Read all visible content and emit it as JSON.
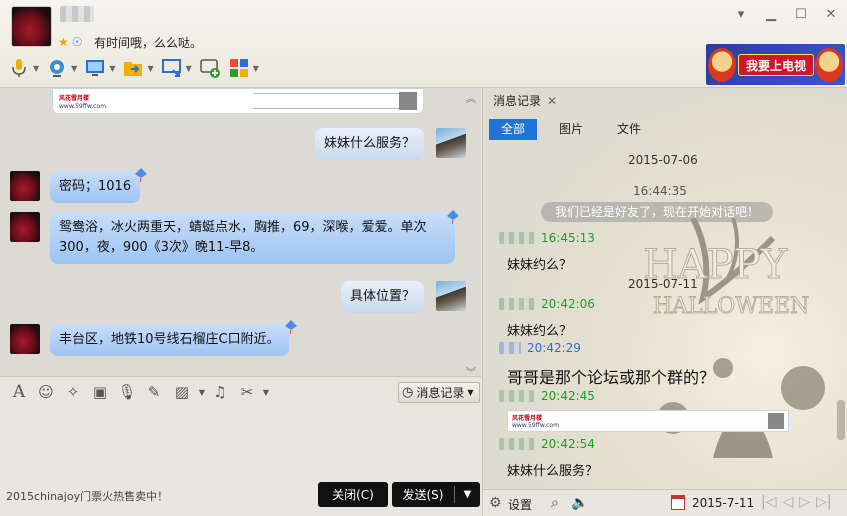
{
  "header": {
    "contact_name": "██",
    "signature": "有时间哦，么么哒。"
  },
  "banner": {
    "text": "我要上电视"
  },
  "chat": {
    "image_card": {
      "logo": "风花雪月楼",
      "url": "www.59ffw.com"
    },
    "messages": [
      {
        "side": "right",
        "text": "妹妹什么服务？"
      },
      {
        "side": "left",
        "text": "密码；1016"
      },
      {
        "side": "left",
        "text": "鸳鸯浴，冰火两重天，蜻蜓点水，胸推，69，深喉，爱爱。单次300，夜，900《3次》晚11-早8。"
      },
      {
        "side": "right",
        "text": "具体位置？"
      },
      {
        "side": "left",
        "text": "丰台区，地铁10号线石榴庄C口附近。"
      }
    ]
  },
  "input_toolbar": {
    "history_label": "消息记录"
  },
  "input": {
    "ad_text": "2015chinajoy门票火热售卖中！",
    "close_label": "关闭(C)",
    "send_label": "发送(S)"
  },
  "history": {
    "tab_label": "消息记录",
    "filters": [
      "全部",
      "图片",
      "文件"
    ],
    "date1": "2015-07-06",
    "time1": "16:44:35",
    "system_msg": "我们已经是好友了，现在开始对话吧！",
    "entries": [
      {
        "time": "16:45:13",
        "text": "妹妹约么？"
      },
      {
        "time": "20:42:06",
        "text": "妹妹约么？"
      },
      {
        "time": "20:42:29",
        "text": "哥哥是那个论坛或那个群的？"
      },
      {
        "time": "20:42:45",
        "text": ""
      },
      {
        "time": "20:42:54",
        "text": "妹妹什么服务？"
      }
    ],
    "date2": "2015-07-11",
    "image_card": {
      "logo": "风花雪月楼",
      "url": "www.59ffw.com"
    },
    "footer": {
      "settings_label": "设置",
      "date": "2015-7-11"
    }
  },
  "colors": {
    "accent_blue": "#1e74d8",
    "sender_green": "#1a9e28",
    "sender_blue": "#2a6ed6",
    "bubble_blue": "#9ec4f2"
  }
}
